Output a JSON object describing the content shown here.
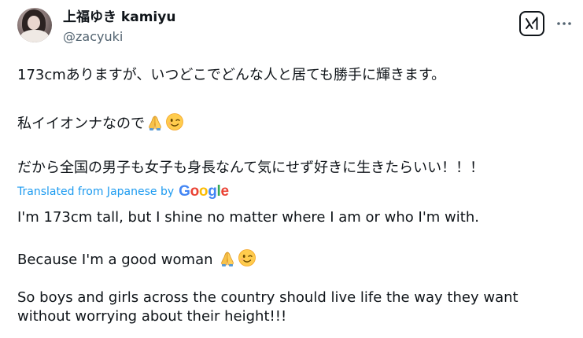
{
  "author": {
    "display_name": "上福ゆき kamiyu",
    "handle": "@zacyuki"
  },
  "actions": {
    "grok_icon": "grok-icon",
    "more_icon": "more-dots-icon"
  },
  "original": {
    "line1": "173cmありますが、いつどこでどんな人と居ても勝手に輝きます。",
    "line2": "私イイオンナなので",
    "line3": "だから全国の男子も女子も身長なんて気にせず好きに生きたらいい！！！"
  },
  "translation": {
    "label": "Translated from Japanese by",
    "provider": "Google",
    "line1": "I'm 173cm tall, but I shine no matter where I am or who I'm with.",
    "line2": "Because I'm a good woman",
    "line3": "So boys and girls across the country should live life the way they want",
    "line4": "without worrying about their height!!!"
  },
  "emojis": [
    "folded-hands-icon",
    "winking-face-icon"
  ],
  "colors": {
    "text": "#0f1419",
    "secondary": "#536471",
    "link": "#1d9bf0"
  }
}
